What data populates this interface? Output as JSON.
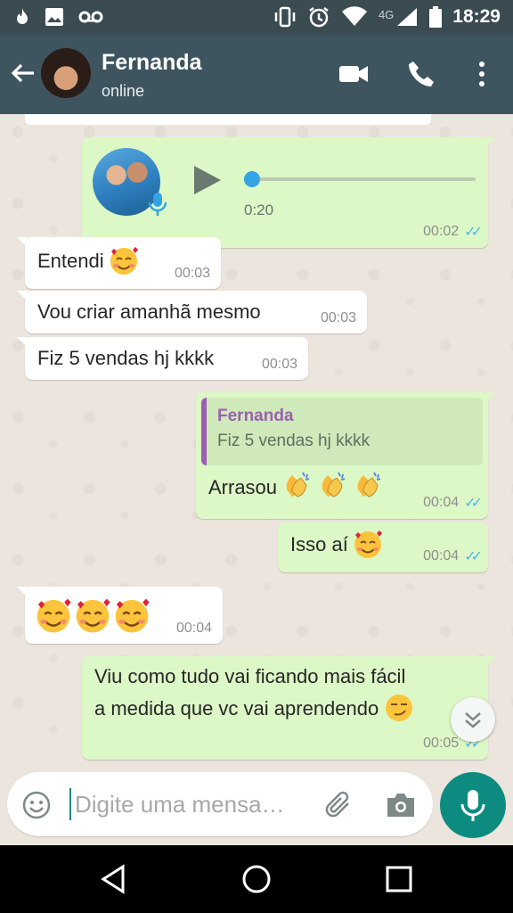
{
  "status_bar": {
    "time": "18:29",
    "network": "4G",
    "left_icons": [
      "fire-icon",
      "image-icon",
      "voicemail-icon"
    ],
    "right_icons": [
      "vibrate-icon",
      "alarm-icon",
      "wifi-icon",
      "signal-icon",
      "battery-icon"
    ]
  },
  "header": {
    "contact_name": "Fernanda",
    "contact_status": "online",
    "icons": [
      "back-arrow-icon",
      "video-call-icon",
      "phone-icon",
      "more-vert-icon"
    ]
  },
  "messages": [
    {
      "direction": "out",
      "type": "voice",
      "duration": "0:20",
      "time": "00:02",
      "read": true
    },
    {
      "direction": "in",
      "text": "Entendi",
      "emoji": "smiling-face-with-hearts",
      "time": "00:03"
    },
    {
      "direction": "in",
      "text": "Vou criar amanhã mesmo",
      "time": "00:03"
    },
    {
      "direction": "in",
      "text": "Fiz 5 vendas hj kkkk",
      "time": "00:03"
    },
    {
      "direction": "out",
      "quote_name": "Fernanda",
      "quote_text": "Fiz 5 vendas hj kkkk",
      "text": "Arrasou",
      "emoji": "clapping-hands x3",
      "time": "00:04",
      "read": true
    },
    {
      "direction": "out",
      "text": "Isso aí",
      "emoji": "smiling-face-with-hearts",
      "time": "00:04",
      "read": true
    },
    {
      "direction": "in",
      "text": "",
      "emoji": "smiling-face-with-hearts x3",
      "time": "00:04"
    },
    {
      "direction": "out",
      "line1": "Viu como tudo vai ficando mais fácil",
      "line2": "a medida que vc vai aprendendo",
      "emoji": "smirking-face",
      "time": "00:05",
      "read": true
    }
  ],
  "input": {
    "placeholder": "Digite uma mensa…"
  },
  "colors": {
    "header": "#3e5560",
    "incoming": "#ffffff",
    "outgoing": "#dcf8c6",
    "read_ticks": "#4fb6ec",
    "accent": "#0d8b80",
    "quote_bar": "#9c5fb3"
  }
}
